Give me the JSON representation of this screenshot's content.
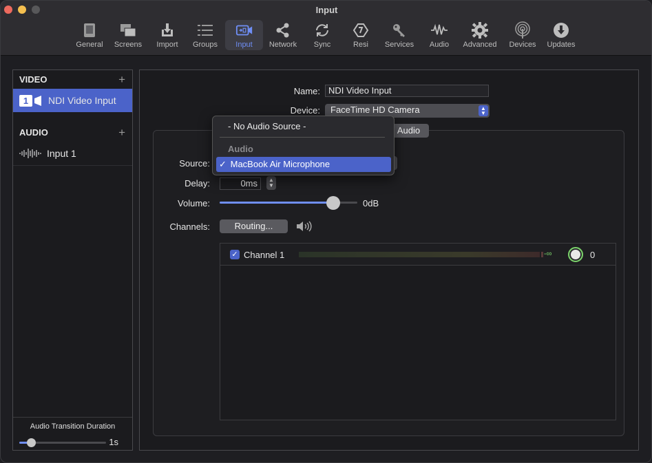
{
  "window": {
    "title": "Input"
  },
  "toolbar": {
    "items": [
      {
        "label": "General",
        "icon": "general-icon"
      },
      {
        "label": "Screens",
        "icon": "screens-icon"
      },
      {
        "label": "Import",
        "icon": "import-icon"
      },
      {
        "label": "Groups",
        "icon": "groups-icon"
      },
      {
        "label": "Input",
        "icon": "input-icon",
        "active": true
      },
      {
        "label": "Network",
        "icon": "network-icon"
      },
      {
        "label": "Sync",
        "icon": "sync-icon"
      },
      {
        "label": "Resi",
        "icon": "resi-icon"
      },
      {
        "label": "Services",
        "icon": "services-icon"
      },
      {
        "label": "Audio",
        "icon": "audio-icon"
      },
      {
        "label": "Advanced",
        "icon": "advanced-icon"
      },
      {
        "label": "Devices",
        "icon": "devices-icon"
      },
      {
        "label": "Updates",
        "icon": "updates-icon"
      }
    ]
  },
  "sidebar": {
    "video_header": "VIDEO",
    "audio_header": "AUDIO",
    "add_symbol": "+",
    "video_items": [
      {
        "label": "NDI Video Input",
        "badge": "1"
      }
    ],
    "audio_items": [
      {
        "label": "Input 1"
      }
    ],
    "footer": {
      "label": "Audio Transition Duration",
      "value": "1s",
      "slider_fraction": 0.1
    }
  },
  "form": {
    "name_label": "Name:",
    "name_value": "NDI Video Input",
    "device_label": "Device:",
    "device_value": "FaceTime HD Camera",
    "tab_audio": "Audio",
    "source_label": "Source:",
    "delay_label": "Delay:",
    "delay_value": "0ms",
    "volume_label": "Volume:",
    "volume_value": "0dB",
    "volume_fraction": 0.86,
    "channels_label": "Channels:",
    "routing_button": "Routing...",
    "channels": [
      {
        "label": "Channel 1",
        "checked": true,
        "meter_text": "-∞",
        "gain_value": "0"
      }
    ]
  },
  "dropdown": {
    "items": [
      {
        "label": "- No Audio Source -"
      },
      {
        "label": "Audio",
        "section_header": true
      },
      {
        "label": "MacBook Air Microphone",
        "checked": true,
        "check": "✓"
      }
    ]
  },
  "colors": {
    "accent": "#4b63c9",
    "active_label": "#6f8ef5",
    "meter_green": "#7bd36b"
  }
}
